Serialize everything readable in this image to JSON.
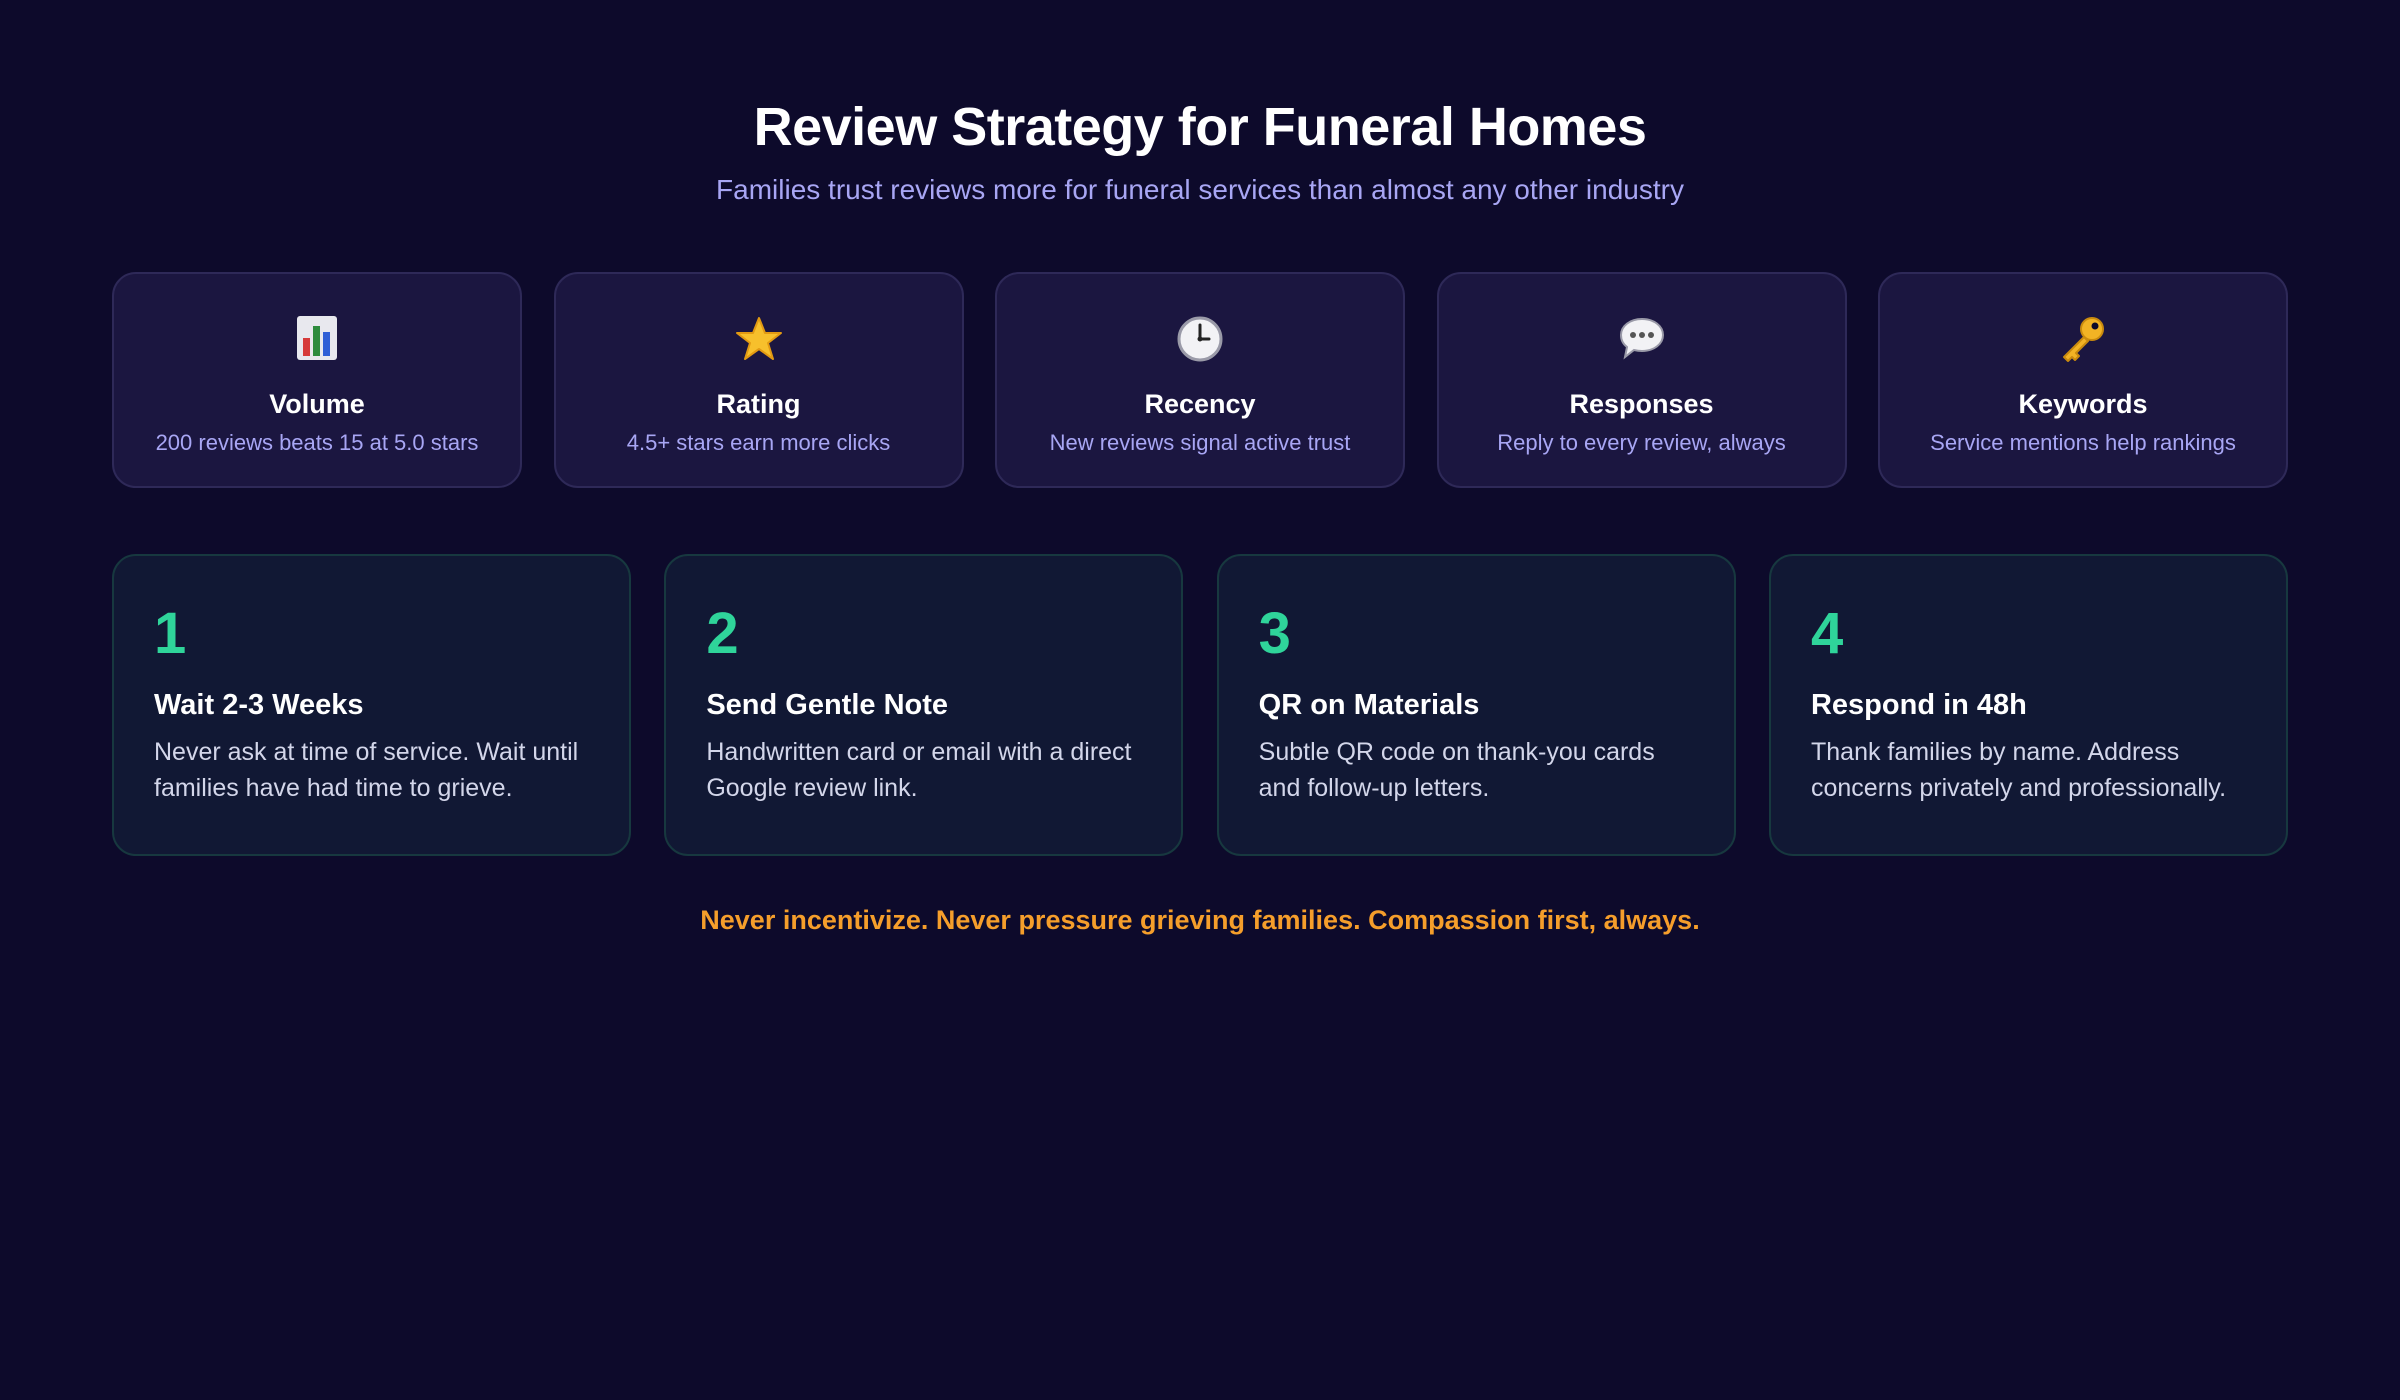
{
  "header": {
    "title": "Review Strategy for Funeral Homes",
    "subtitle": "Families trust reviews more for funeral services than almost any other industry"
  },
  "factors": [
    {
      "icon": "bar-chart-icon",
      "title": "Volume",
      "description": "200 reviews beats 15 at 5.0 stars"
    },
    {
      "icon": "star-icon",
      "title": "Rating",
      "description": "4.5+ stars earn more clicks"
    },
    {
      "icon": "clock-icon",
      "title": "Recency",
      "description": "New reviews signal active trust"
    },
    {
      "icon": "speech-bubble-icon",
      "title": "Responses",
      "description": "Reply to every review, always"
    },
    {
      "icon": "key-icon",
      "title": "Keywords",
      "description": "Service mentions help rankings"
    }
  ],
  "steps": [
    {
      "number": "1",
      "title": "Wait 2-3 Weeks",
      "description": "Never ask at time of service. Wait until families have had time to grieve."
    },
    {
      "number": "2",
      "title": "Send Gentle Note",
      "description": "Handwritten card or email with a direct Google review link."
    },
    {
      "number": "3",
      "title": "QR on Materials",
      "description": "Subtle QR code on thank-you cards and follow-up letters."
    },
    {
      "number": "4",
      "title": "Respond in 48h",
      "description": "Thank families by name. Address concerns privately and professionally."
    }
  ],
  "footer": {
    "note": "Never incentivize. Never pressure grieving families. Compassion first, always."
  },
  "colors": {
    "background": "#0d0a2b",
    "accent_green": "#2fd49a",
    "accent_orange": "#f59e2b",
    "subtitle_lavender": "#a8a6f4"
  }
}
